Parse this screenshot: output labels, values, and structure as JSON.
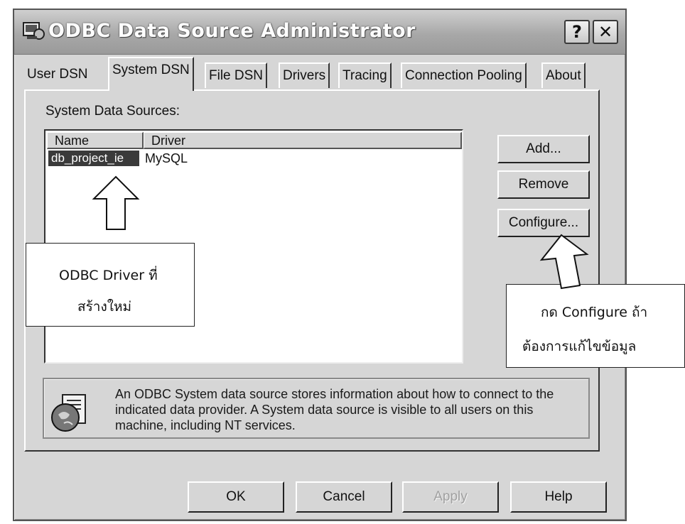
{
  "window": {
    "title": "ODBC Data Source Administrator",
    "help_glyph": "?",
    "close_glyph": "✕"
  },
  "tabs": [
    {
      "label": "User DSN"
    },
    {
      "label": "System DSN",
      "active": true
    },
    {
      "label": "File DSN"
    },
    {
      "label": "Drivers"
    },
    {
      "label": "Tracing"
    },
    {
      "label": "Connection Pooling"
    },
    {
      "label": "About"
    }
  ],
  "panel": {
    "section_label": "System Data Sources:",
    "columns": [
      "Name",
      "Driver"
    ],
    "rows": [
      {
        "name": "db_project_ie",
        "driver": "MySQL",
        "selected": true
      }
    ],
    "buttons": {
      "add": "Add...",
      "remove": "Remove",
      "configure": "Configure..."
    },
    "info_text": "An ODBC System data source stores information about how to connect to the indicated data provider.  A System data source is visible to all users on this machine, including NT services.",
    "info_icon": "odbc-globe-icon"
  },
  "footer_buttons": {
    "ok": "OK",
    "cancel": "Cancel",
    "apply": "Apply",
    "help": "Help"
  },
  "annotations": {
    "left": {
      "line1": "ODBC Driver ที่",
      "line2": "สร้างใหม่"
    },
    "right": {
      "line1": "กด Configure ถ้า",
      "line2": "ต้องการแก้ไขข้อมูล"
    }
  }
}
